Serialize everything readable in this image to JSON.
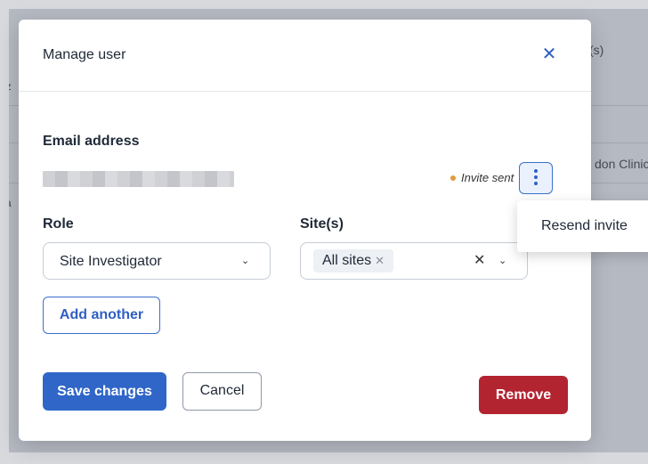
{
  "background": {
    "column_header": "(s)",
    "left_cells": [
      "dz",
      "st",
      "is",
      "ca",
      "ni"
    ],
    "right_cell": "don Clinic"
  },
  "modal": {
    "title": "Manage user",
    "close_icon": "close-icon",
    "email_label": "Email address",
    "invite_status": "Invite sent",
    "status_color": "#e29a3c",
    "role_label": "Role",
    "role_value": "Site Investigator",
    "sites_label": "Site(s)",
    "sites_chip": "All sites",
    "add_another": "Add another",
    "save_changes": "Save changes",
    "cancel": "Cancel",
    "remove": "Remove",
    "accent_color": "#2f66c8",
    "danger_color": "#b32431"
  },
  "menu": {
    "items": [
      {
        "label": "Resend invite"
      }
    ]
  }
}
